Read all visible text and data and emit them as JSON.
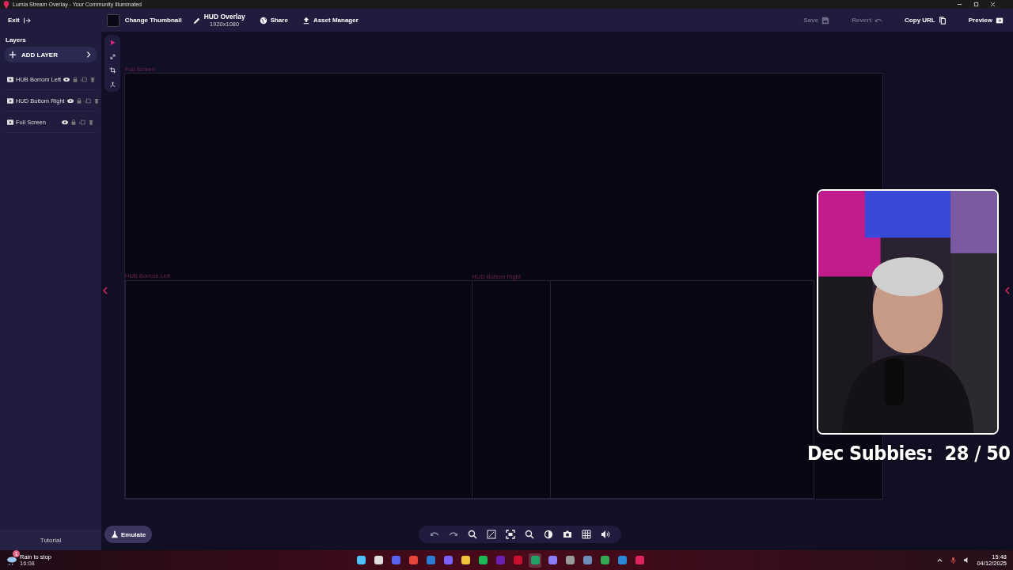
{
  "window": {
    "title": "Lumia Stream Overlay - Your Community Illuminated"
  },
  "toolbar": {
    "exit": "Exit",
    "thumbnail": "Change Thumbnail",
    "overlay_name": "HUD Overlay",
    "resolution": "1920x1080",
    "share": "Share",
    "asset_manager": "Asset Manager",
    "actions": [
      {
        "label": "Save",
        "kind": "save",
        "disabled": true
      },
      {
        "label": "Revert",
        "kind": "revert",
        "disabled": true
      },
      {
        "label": "Copy URL",
        "kind": "copy",
        "disabled": false
      },
      {
        "label": "Preview",
        "kind": "preview",
        "disabled": false
      }
    ]
  },
  "sidebar": {
    "title": "Layers",
    "add_button": "ADD LAYER",
    "layers": [
      {
        "name": "HUB Borrom Left"
      },
      {
        "name": "HUD Buttom Right"
      },
      {
        "name": "Full Screen"
      }
    ],
    "tutorial": "Tutorial"
  },
  "tools": [
    {
      "kind": "select",
      "selected": true
    },
    {
      "kind": "resize",
      "selected": false
    },
    {
      "kind": "crop",
      "selected": false
    },
    {
      "kind": "anchor",
      "selected": false
    }
  ],
  "canvas": {
    "layers": [
      {
        "label": "Full Screen"
      },
      {
        "label": "HUB Borrom Left"
      },
      {
        "label": "HUD Buttom Right"
      }
    ],
    "overlay_text": "Dec Subbies:  28 / 50"
  },
  "emulate": "Emulate",
  "taskbar": {
    "weather": "Rain to stop",
    "weather_time": "16:08",
    "weather_badge": "1",
    "time": "15:48",
    "date": "04/12/2025",
    "apps": [
      {
        "color": "#4cc2ff",
        "selected": false
      },
      {
        "color": "#dddddd",
        "selected": false
      },
      {
        "color": "#5865f2",
        "selected": false
      },
      {
        "color": "#e8453c",
        "selected": false
      },
      {
        "color": "#2b7cd3",
        "selected": false
      },
      {
        "color": "#7b61ff",
        "selected": false
      },
      {
        "color": "#f3c33c",
        "selected": false
      },
      {
        "color": "#1db954",
        "selected": false
      },
      {
        "color": "#6a1fb5",
        "selected": false
      },
      {
        "color": "#c8102e",
        "selected": false
      },
      {
        "color": "#21a366",
        "selected": true
      },
      {
        "color": "#8b7cf6",
        "selected": false
      },
      {
        "color": "#9a9a9a",
        "selected": false
      },
      {
        "color": "#6d8bb5",
        "selected": false
      },
      {
        "color": "#34a853",
        "selected": false
      },
      {
        "color": "#2b88d8",
        "selected": false
      },
      {
        "color": "#e0245e",
        "selected": false
      }
    ]
  }
}
